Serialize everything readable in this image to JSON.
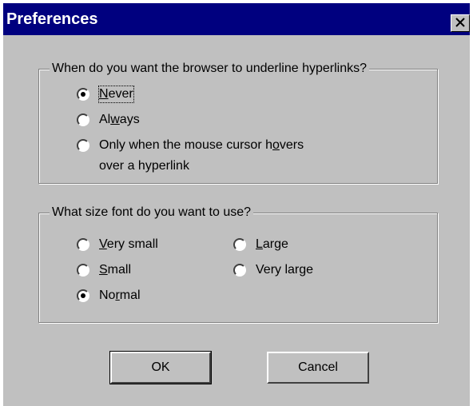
{
  "window": {
    "title": "Preferences",
    "close_icon": "close-icon"
  },
  "underline_group": {
    "legend": "When do you want the browser to underline hyperlinks?",
    "options": [
      {
        "pre": "",
        "u": "N",
        "post": "ever",
        "selected": true,
        "focused": true
      },
      {
        "pre": "Al",
        "u": "w",
        "post": "ays",
        "selected": false,
        "focused": false
      },
      {
        "pre": "Only when the mouse cursor h",
        "u": "o",
        "post": "vers",
        "line2": "over a hyperlink",
        "selected": false,
        "focused": false
      }
    ]
  },
  "fontsize_group": {
    "legend": "What size font do you want to use?",
    "options": [
      {
        "pre": "",
        "u": "V",
        "post": "ery small",
        "selected": false
      },
      {
        "pre": "",
        "u": "S",
        "post": "mall",
        "selected": false
      },
      {
        "pre": "No",
        "u": "r",
        "post": "mal",
        "selected": true
      },
      {
        "pre": "",
        "u": "L",
        "post": "arge",
        "selected": false
      },
      {
        "pre": "",
        "u": "",
        "post": "Very large",
        "selected": false
      }
    ]
  },
  "buttons": {
    "ok_label": "OK",
    "cancel_label": "Cancel"
  },
  "colors": {
    "titlebar": "#00007f",
    "face": "#c0c0c0"
  }
}
